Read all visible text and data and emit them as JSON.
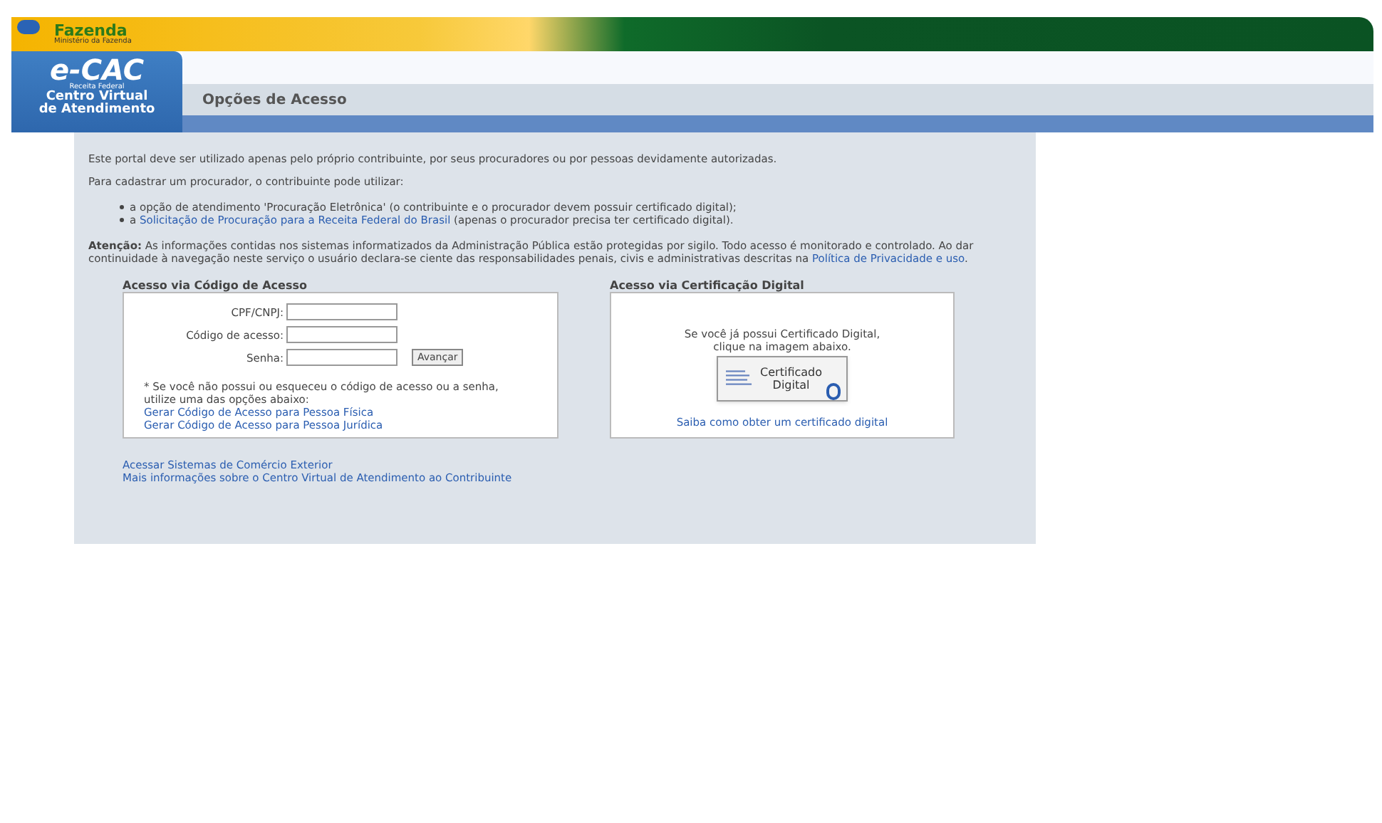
{
  "header": {
    "brand": "Fazenda",
    "ministry": "Ministério da Fazenda"
  },
  "logo": {
    "name": "e-CAC",
    "agency": "Receita Federal",
    "line1": "Centro Virtual",
    "line2": "de Atendimento"
  },
  "page_title": "Opções de Acesso",
  "intro": "Este portal deve ser utilizado apenas pelo próprio contribuinte, por seus procuradores ou por pessoas devidamente autorizadas.",
  "lead": "Para cadastrar um procurador, o contribuinte pode utilizar:",
  "options": [
    {
      "text": "a opção de atendimento 'Procuração Eletrônica' (o contribuinte e o procurador devem possuir certificado digital);"
    },
    {
      "link": "Solicitação de Procuração para a Receita Federal do Brasil",
      "prefix": "a",
      "text": "(apenas o procurador precisa ter certificado digital)."
    }
  ],
  "notice": {
    "label": "Atenção:",
    "text": "As informações contidas nos sistemas informatizados da Administração Pública estão protegidas por sigilo. Todo acesso é monitorado e controlado. Ao dar continuidade à navegação neste serviço o usuário declara-se ciente das responsabilidades penais, civis e administrativas descritas na",
    "link": "Política de Privacidade e uso",
    "end": "."
  },
  "code_access": {
    "title": "Acesso via Código de Acesso",
    "fields": [
      {
        "label": "CPF/CNPJ:"
      },
      {
        "label": "Código de acesso:"
      },
      {
        "label": "Senha:"
      }
    ],
    "button": "Avançar",
    "help": "* Se você não possui ou esqueceu o código de acesso ou a senha, utilize uma das opções abaixo:",
    "links": [
      "Gerar Código de Acesso para Pessoa Física",
      "Gerar Código de Acesso para Pessoa Jurídica"
    ]
  },
  "cert_access": {
    "title": "Acesso via Certificação Digital",
    "text": "Se você já possui Certificado Digital, clique na imagem abaixo.",
    "button_line1": "Certificado",
    "button_line2": "Digital",
    "link": "Saiba como obter um certificado digital"
  },
  "footer_links": [
    "Acessar Sistemas de Comércio Exterior",
    "Mais informações sobre o Centro Virtual de Atendimento ao Contribuinte"
  ]
}
